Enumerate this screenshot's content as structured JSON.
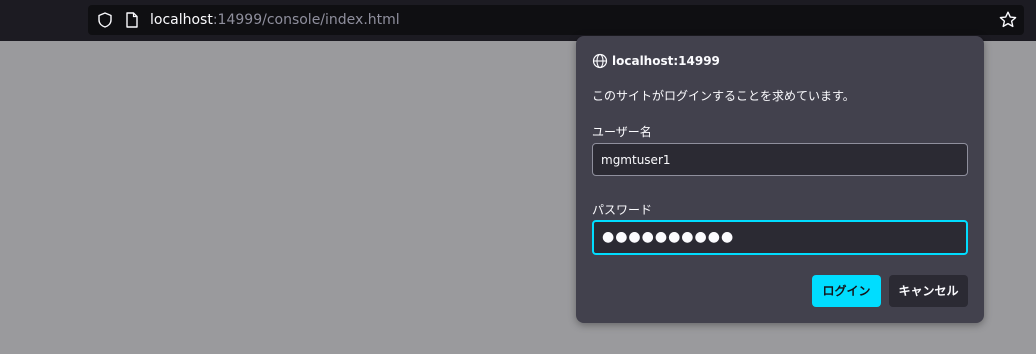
{
  "browser": {
    "url_host": "localhost",
    "url_path": ":14999/console/index.html",
    "icons": {
      "shield": "shield-icon",
      "page": "page-icon",
      "bookmark": "star-icon"
    }
  },
  "dialog": {
    "origin": "localhost:14999",
    "origin_icon": "globe-icon",
    "message": "このサイトがログインすることを求めています。",
    "username_label": "ユーザー名",
    "username_value": "mgmtuser1",
    "password_label": "パスワード",
    "password_mask": "●●●●●●●●●●",
    "login_label": "ログイン",
    "cancel_label": "キャンセル"
  },
  "colors": {
    "accent": "#00ddff",
    "dialog_bg": "#42414d",
    "page_bg": "#9a9a9d"
  }
}
